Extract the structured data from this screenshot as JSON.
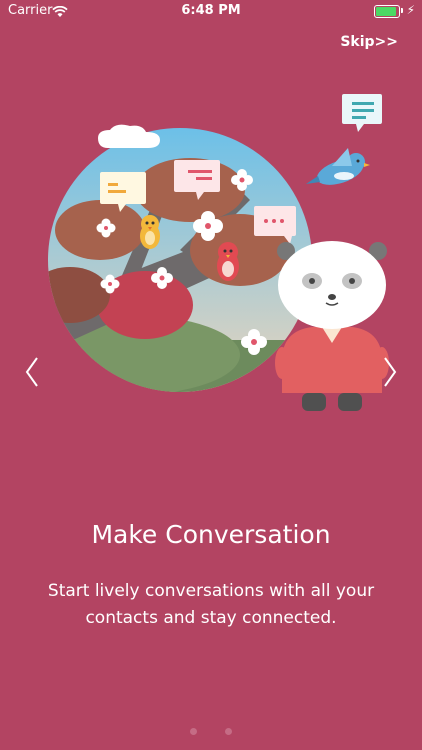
{
  "status_bar": {
    "carrier": "Carrier",
    "time": "6:48 PM",
    "battery_level": 0.9,
    "battery_color": "#4cd964"
  },
  "top": {
    "skip_label": "Skip>>"
  },
  "slide": {
    "title": "Make Conversation",
    "description": "Start lively conversations with all your contacts and stay connected."
  },
  "navigation": {
    "prev_icon": "chevron-left-icon",
    "next_icon": "chevron-right-icon",
    "page_count": 2,
    "current_page": 1
  },
  "colors": {
    "background": "#b34462",
    "text": "#ffffff",
    "dot": "#c56c85"
  }
}
